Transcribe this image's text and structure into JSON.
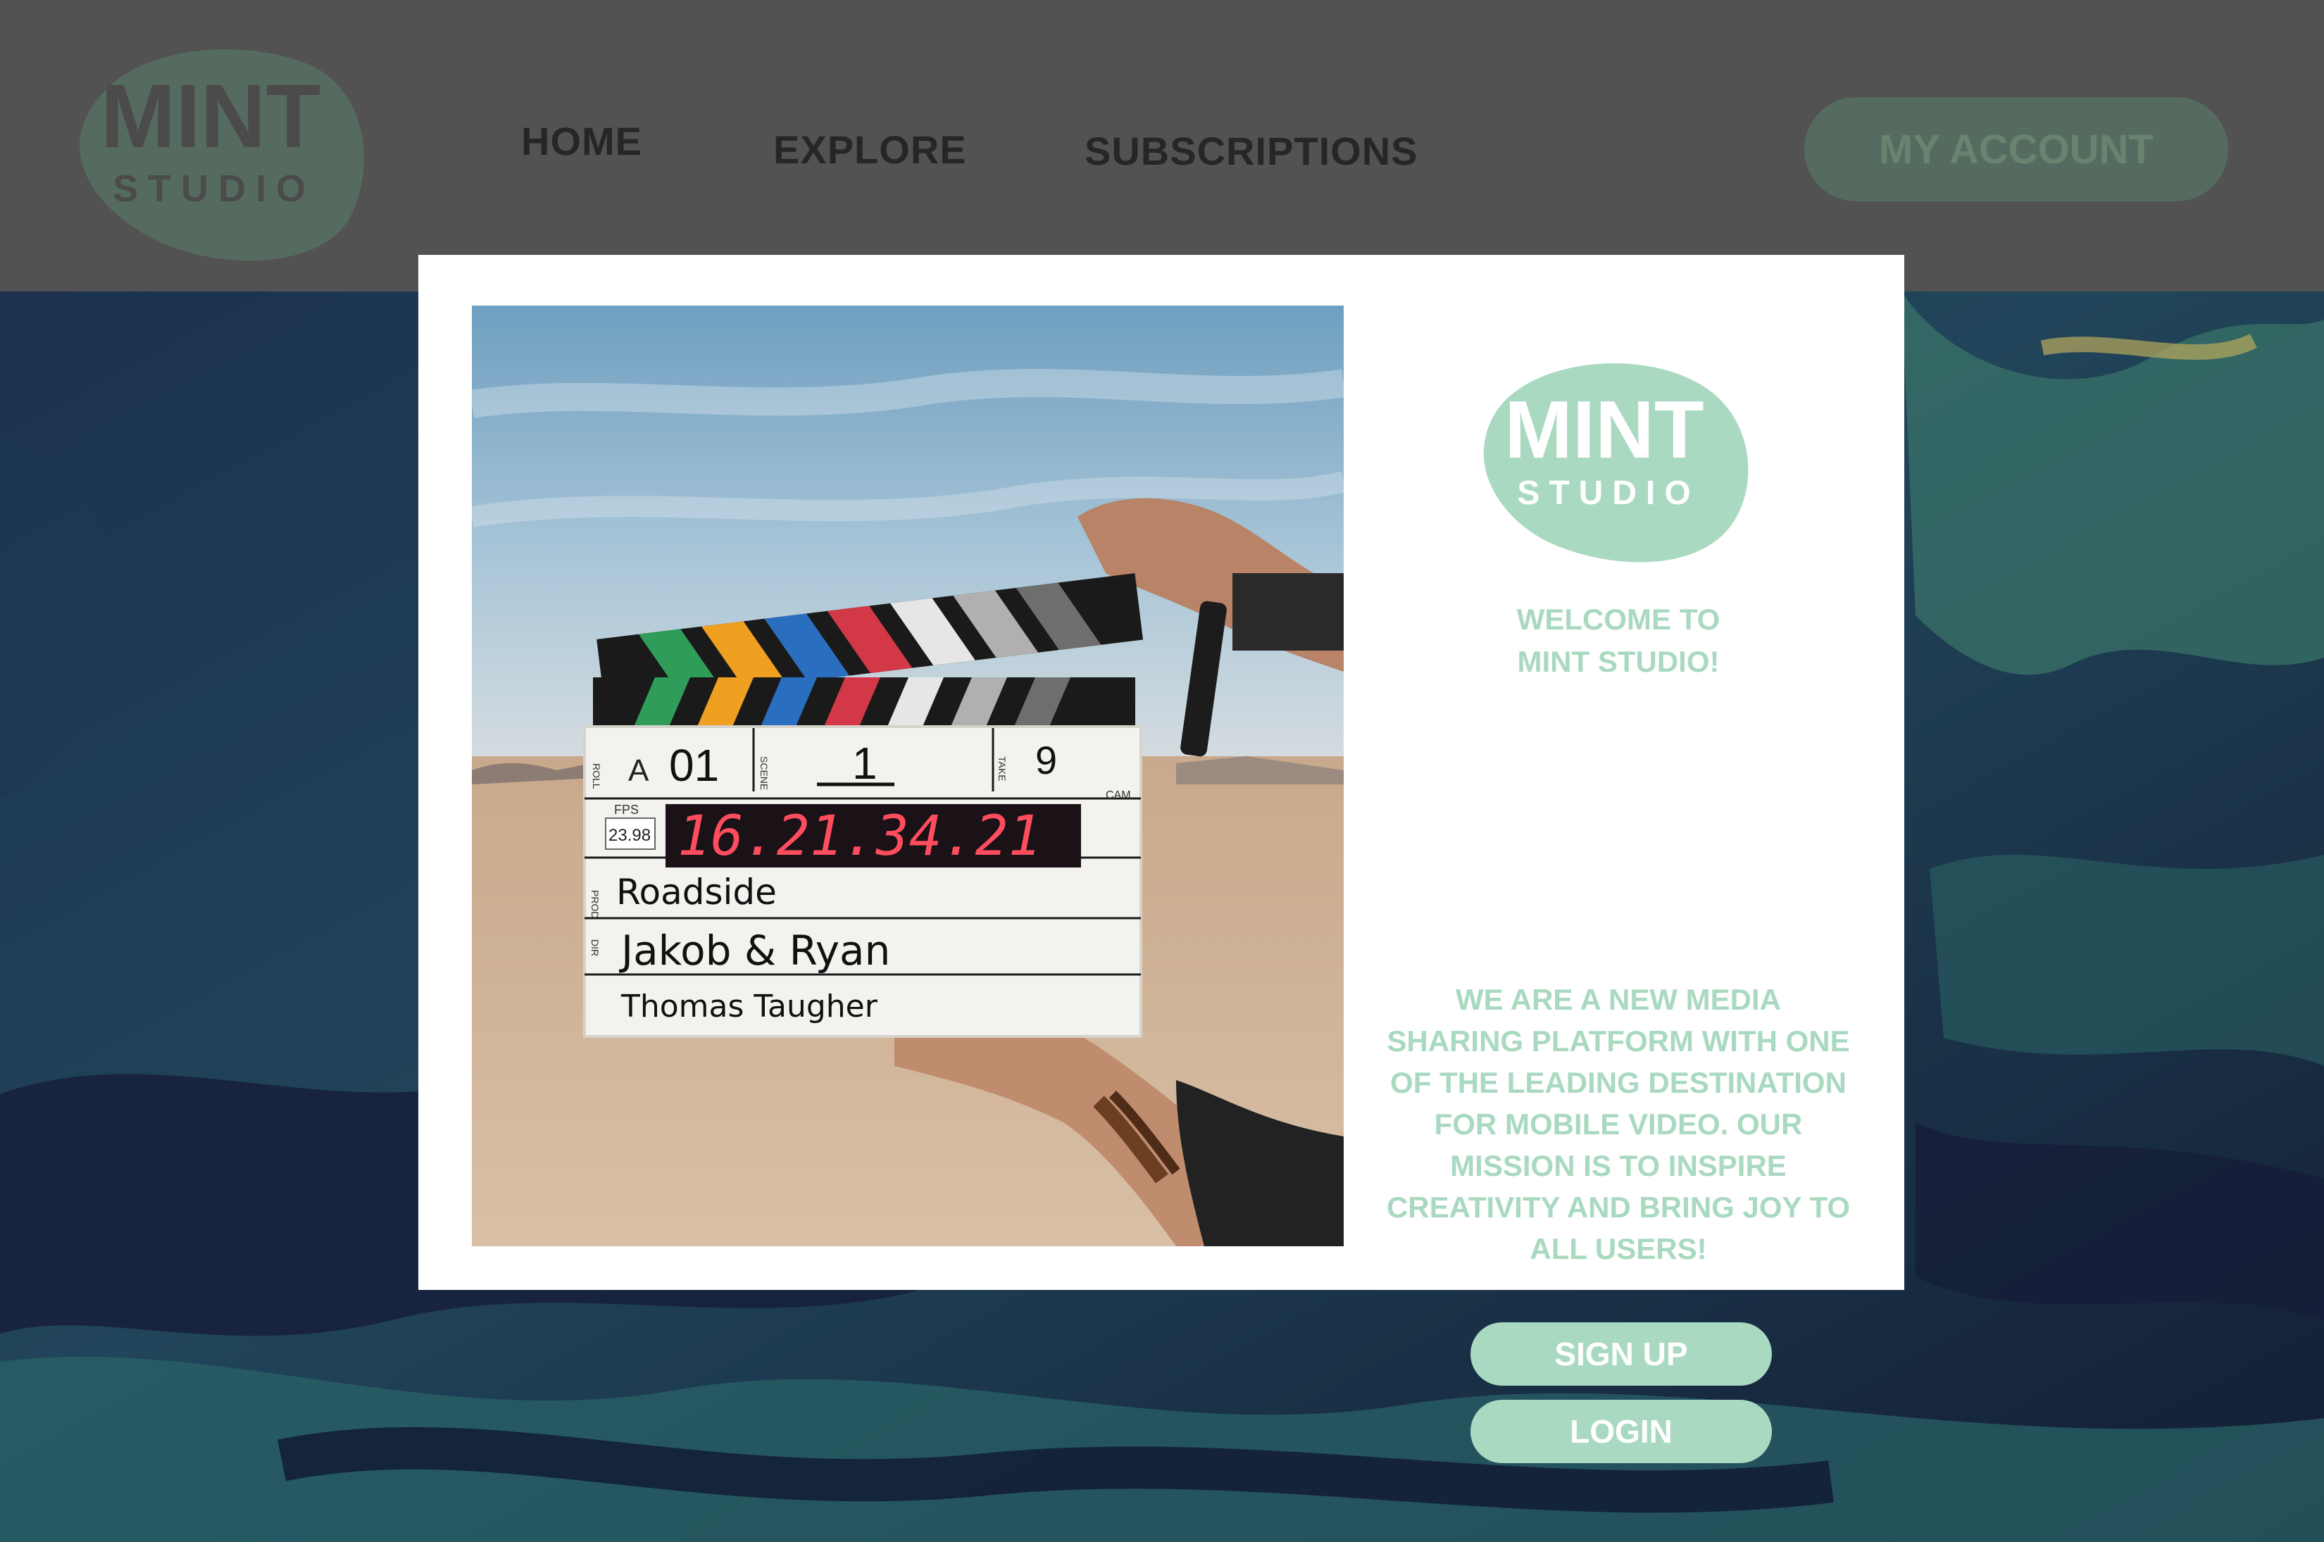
{
  "brand": {
    "name_top": "MINT",
    "name_bottom": "STUDIO"
  },
  "nav": {
    "home": "HOME",
    "explore": "EXPLORE",
    "subscriptions": "SUBSCRIPTIONS",
    "account": "MY ACCOUNT"
  },
  "modal": {
    "welcome_line1": "WELCOME TO",
    "welcome_line2": "MINT STUDIO!",
    "description": "WE ARE A NEW MEDIA SHARING PLATFORM WITH ONE OF THE LEADING DESTINATION FOR MOBILE VIDEO. OUR MISSION IS TO INSPIRE CREATIVITY AND BRING JOY TO ALL USERS!",
    "signup": "SIGN UP",
    "login": "LOGIN"
  },
  "clapperboard": {
    "roll_label": "ROLL",
    "roll": "A",
    "scene_label": "SCENE",
    "scene": "01",
    "take_label": "TAKE",
    "shot": "1",
    "take": "9",
    "fps_label": "FPS",
    "fps": "23.98",
    "cam_label": "CAM",
    "timecode": "16.21.34.21",
    "prod_label": "PROD",
    "production": "Roadside",
    "dir_label": "DIR",
    "director": "Jakob & Ryan",
    "camera": "Thomas Taugher"
  },
  "colors": {
    "mint": "#a9d9c0",
    "header_bg": "#525252",
    "account_bg": "#566b5f",
    "timecode_red": "#ff4d5e"
  }
}
